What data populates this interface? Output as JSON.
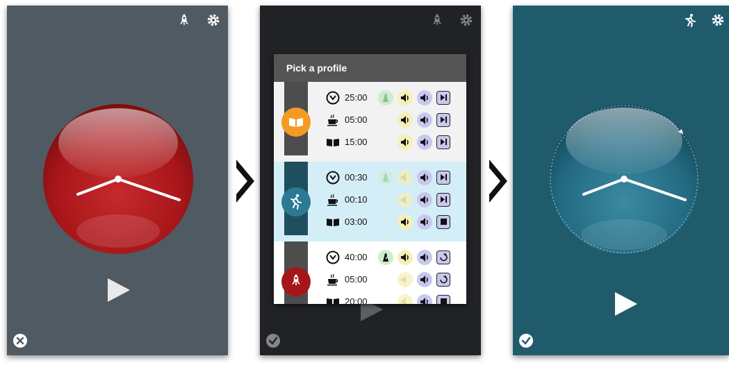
{
  "screens": {
    "left": {
      "top_icons": [
        "rocket-icon",
        "gear-icon"
      ],
      "clock_color": "#b0191c",
      "play_icon": "play-icon",
      "corner_icon": "close-circle-icon"
    },
    "middle": {
      "top_icons": [
        "rocket-icon",
        "gear-icon"
      ],
      "dialog_title": "Pick a profile",
      "profiles": [
        {
          "badge_icon": "book-icon",
          "badge_color": "#f59a23",
          "strip_color": "#4d4d4d",
          "rows": [
            {
              "icon": "timer-icon",
              "time": "25:00"
            },
            {
              "icon": "coffee-icon",
              "time": "05:00"
            },
            {
              "icon": "book-icon",
              "time": "15:00"
            }
          ]
        },
        {
          "badge_icon": "runner-icon",
          "badge_color": "#2a7a94",
          "strip_color": "#1f4f5e",
          "rows": [
            {
              "icon": "timer-icon",
              "time": "00:30"
            },
            {
              "icon": "coffee-icon",
              "time": "00:10"
            },
            {
              "icon": "book-icon",
              "time": "03:00"
            }
          ]
        },
        {
          "badge_icon": "rocket-icon",
          "badge_color": "#a4161a",
          "strip_color": "#4d4d4d",
          "rows": [
            {
              "icon": "timer-icon",
              "time": "40:00"
            },
            {
              "icon": "coffee-icon",
              "time": "05:00"
            },
            {
              "icon": "book-icon",
              "time": "20:00"
            }
          ]
        }
      ],
      "corner_icon": "check-circle-icon"
    },
    "right": {
      "top_icons": [
        "runner-icon",
        "gear-icon"
      ],
      "clock_color": "#2a7088",
      "play_icon": "play-icon",
      "corner_icon": "check-circle-icon"
    }
  },
  "colors": {
    "left_bg": "#505a62",
    "middle_bg": "#202226",
    "right_bg": "#205b6c",
    "sound_yellow": "#f7efb5",
    "sound_purple": "#c8c8ef",
    "metronome_green": "#cdeccd"
  }
}
